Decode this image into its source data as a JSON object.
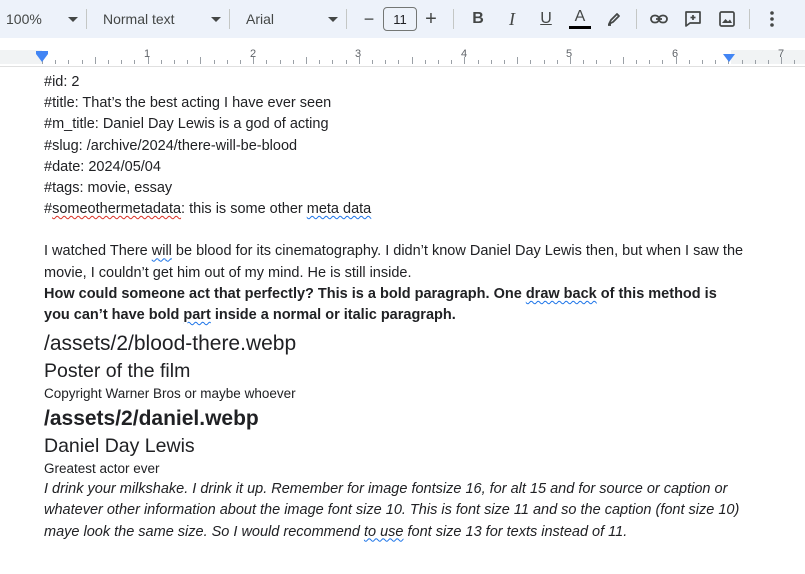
{
  "toolbar": {
    "zoom": "100%",
    "style": "Normal text",
    "font": "Arial",
    "font_size": "11",
    "minus": "−",
    "plus": "+"
  },
  "ruler": {
    "numbers": [
      "1",
      "2",
      "3",
      "4",
      "5",
      "6",
      "7"
    ]
  },
  "doc": {
    "meta": {
      "id_key": "#id",
      "id_val": ": 2",
      "title": "#title: That’s the best acting I have ever seen",
      "m_title": "#m_title: Daniel Day Lewis is a god of acting",
      "slug": "#slug: /archive/2024/there-will-be-blood",
      "date": "#date: 2024/05/04",
      "tags": "#tags: movie, essay",
      "other_prefix": "#",
      "other_word": "someothermetadata",
      "other_mid": ": this is some other ",
      "other_meta": "meta data"
    },
    "p1": {
      "a": "I watched There ",
      "will": "will",
      "b": " be blood for its cinematography. I didn’t know Daniel Day Lewis then, but when I saw the movie, I couldn’t get him out of my mind. He is still inside."
    },
    "p2": {
      "a": "How could someone act that perfectly? This is a bold paragraph. One ",
      "drawback": "draw back",
      "b": " of this method is you can’t have bold ",
      "part": "part",
      "c": " inside a normal or italic paragraph."
    },
    "image1": "/assets/2/blood-there.webp",
    "alt1": "Poster of the film",
    "caption1": "Copyright Warner Bros or maybe whoever",
    "image2": "/assets/2/daniel.webp",
    "alt2": "Daniel Day Lewis",
    "caption2": "Greatest actor ever",
    "p3": {
      "a": "I drink your milkshake. I drink it up. Remember for image fontsize 16, for alt 15 and for source or caption or whatever other information about the image font size 10. This is font size 11 and so the caption (font size 10) maye look the same size. So I would recommend ",
      "touse": "to use",
      "b": " font size 13 for texts instead of 11."
    }
  },
  "colors": {
    "toolbar_bg": "#edf2fa",
    "accent": "#4285f4",
    "spell": "#d93025",
    "grammar": "#1a73e8"
  },
  "icons": [
    "chevron-down-icon",
    "bold-icon",
    "italic-icon",
    "underline-icon",
    "text-color-icon",
    "highlight-pen-icon",
    "link-icon",
    "add-comment-icon",
    "insert-image-icon",
    "more-vert-icon"
  ]
}
